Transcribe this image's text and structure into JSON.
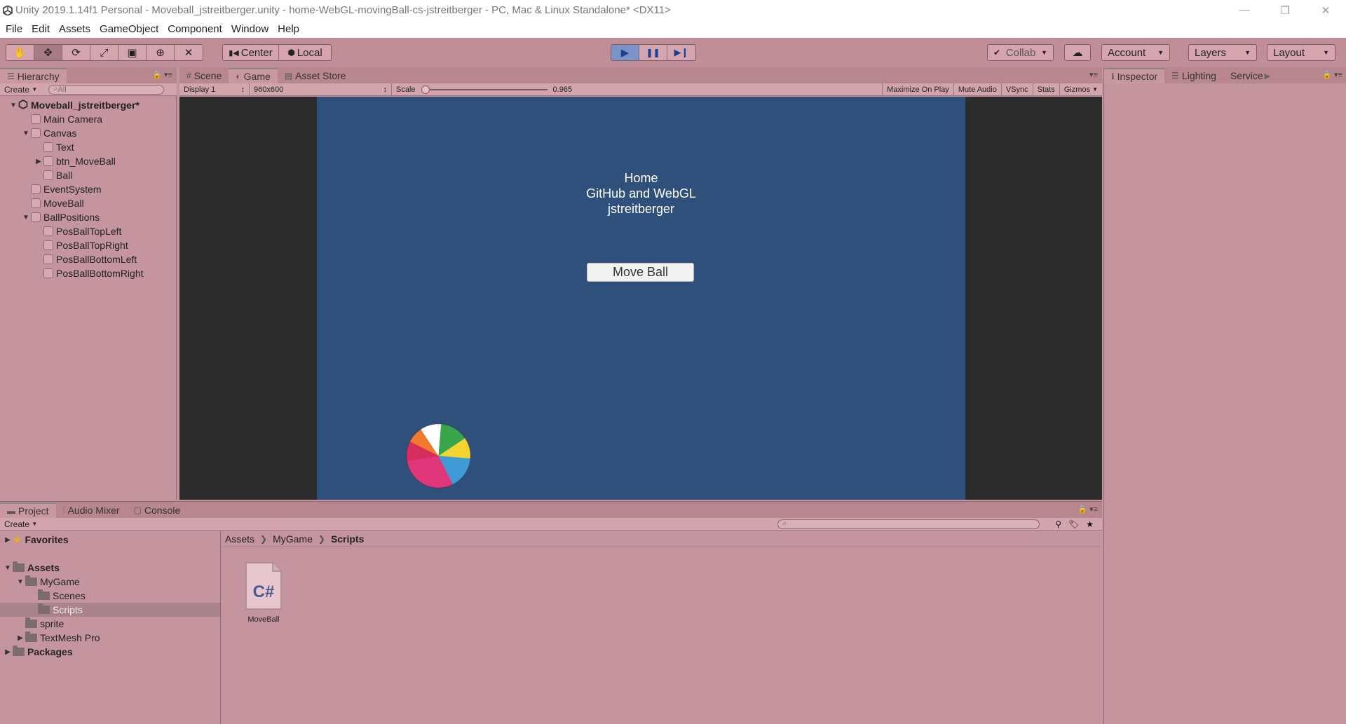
{
  "window": {
    "title": "Unity 2019.1.14f1 Personal - Moveball_jstreitberger.unity - home-WebGL-movingBall-cs-jstreitberger - PC, Mac & Linux Standalone* <DX11>",
    "controls": {
      "minimize": "—",
      "restore": "❐",
      "close": "✕"
    }
  },
  "menu": [
    "File",
    "Edit",
    "Assets",
    "GameObject",
    "Component",
    "Window",
    "Help"
  ],
  "toolbar": {
    "tools": [
      "hand-icon",
      "move-icon",
      "rotate-icon",
      "scale-icon",
      "rect-icon",
      "transform-icon",
      "custom-tool-icon"
    ],
    "pivot": {
      "center": "Center",
      "local": "Local"
    },
    "play": {
      "play": "▶",
      "pause": "❚❚",
      "step": "▶❙"
    },
    "collab": "Collab",
    "account": "Account",
    "layers": "Layers",
    "layout": "Layout",
    "colors": {
      "play_active": "#7a93c8"
    }
  },
  "hierarchy": {
    "tab": "Hierarchy",
    "create": "Create",
    "search_placeholder": "All",
    "items": [
      {
        "label": "Moveball_jstreitberger*",
        "depth": 0,
        "expanded": true,
        "scene": true
      },
      {
        "label": "Main Camera",
        "depth": 1
      },
      {
        "label": "Canvas",
        "depth": 1,
        "expanded": true
      },
      {
        "label": "Text",
        "depth": 2
      },
      {
        "label": "btn_MoveBall",
        "depth": 2,
        "collapsed": true
      },
      {
        "label": "Ball",
        "depth": 2
      },
      {
        "label": "EventSystem",
        "depth": 1
      },
      {
        "label": "MoveBall",
        "depth": 1
      },
      {
        "label": "BallPositions",
        "depth": 1,
        "expanded": true
      },
      {
        "label": "PosBallTopLeft",
        "depth": 2
      },
      {
        "label": "PosBallTopRight",
        "depth": 2
      },
      {
        "label": "PosBallBottomLeft",
        "depth": 2
      },
      {
        "label": "PosBallBottomRight",
        "depth": 2
      }
    ]
  },
  "center_tabs": [
    {
      "label": "Scene",
      "icon": "#"
    },
    {
      "label": "Game",
      "icon": "◐",
      "active": true
    },
    {
      "label": "Asset Store",
      "icon": "▤"
    }
  ],
  "gamebar": {
    "display": "Display 1",
    "resolution": "960x600",
    "scale_label": "Scale",
    "scale_value": "0.965",
    "maximize": "Maximize On Play",
    "mute": "Mute Audio",
    "vsync": "VSync",
    "stats": "Stats",
    "gizmos": "Gizmos"
  },
  "game": {
    "lines": [
      "Home",
      "GitHub and WebGL",
      "jstreitberger"
    ],
    "button": "Move Ball",
    "colors": {
      "background": "#30507c",
      "letterbox": "#2c2c2c"
    }
  },
  "inspector_tabs": [
    {
      "label": "Inspector",
      "icon": "ℹ",
      "active": true
    },
    {
      "label": "Lighting",
      "icon": "☰"
    },
    {
      "label": "Service",
      "icon": ""
    }
  ],
  "bottom_tabs": [
    {
      "label": "Project",
      "icon": "▬",
      "active": true
    },
    {
      "label": "Audio Mixer",
      "icon": "⫶"
    },
    {
      "label": "Console",
      "icon": "▢"
    }
  ],
  "project": {
    "create": "Create",
    "tree": [
      {
        "label": "Favorites",
        "depth": 0,
        "bold": true,
        "icon": "star"
      },
      {
        "label": "",
        "spacer": true
      },
      {
        "label": "Assets",
        "depth": 0,
        "bold": true,
        "expanded": true
      },
      {
        "label": "MyGame",
        "depth": 1,
        "expanded": true
      },
      {
        "label": "Scenes",
        "depth": 2
      },
      {
        "label": "Scripts",
        "depth": 2,
        "selected": true
      },
      {
        "label": "sprite",
        "depth": 1
      },
      {
        "label": "TextMesh Pro",
        "depth": 1,
        "collapsed": true
      },
      {
        "label": "Packages",
        "depth": 0,
        "bold": true,
        "collapsed": true
      }
    ],
    "breadcrumb": [
      "Assets",
      "MyGame",
      "Scripts"
    ],
    "assets": [
      {
        "label": "MoveBall",
        "icon_text": "C#"
      }
    ]
  }
}
